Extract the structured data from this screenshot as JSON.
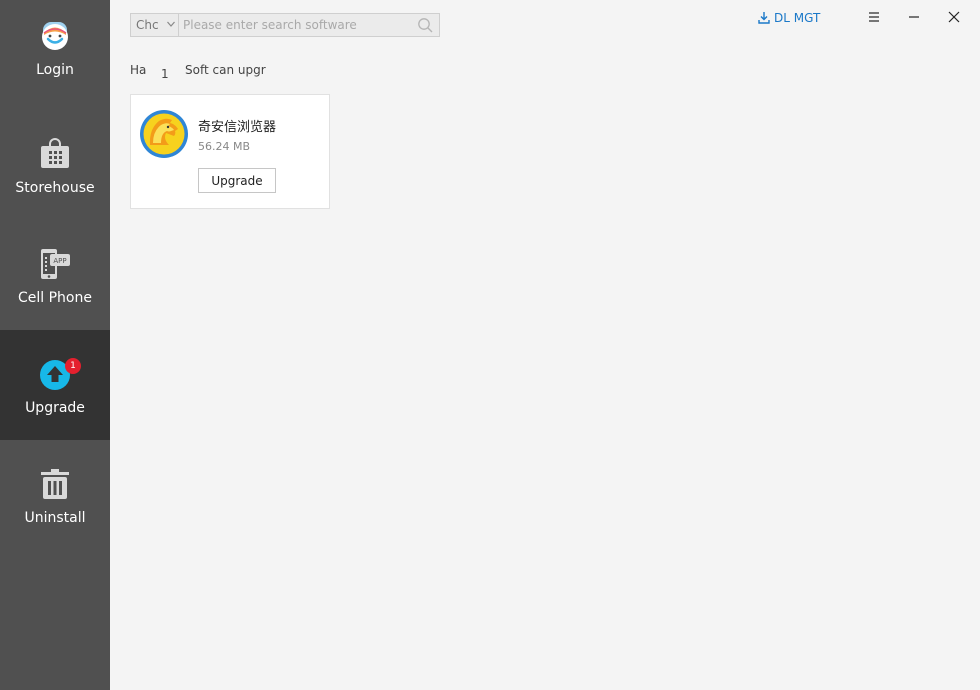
{
  "sidebar": {
    "items": [
      {
        "label": "Login",
        "icon": "avatar-icon"
      },
      {
        "label": "Storehouse",
        "icon": "shopping-bag-icon"
      },
      {
        "label": "Cell Phone",
        "icon": "phone-app-icon",
        "icon_text": "APP"
      },
      {
        "label": "Upgrade",
        "icon": "upgrade-arrow-icon",
        "badge": "1",
        "active": true
      },
      {
        "label": "Uninstall",
        "icon": "trash-icon"
      }
    ]
  },
  "search": {
    "category": "Chc",
    "placeholder": "Please enter search software",
    "value": ""
  },
  "header": {
    "download_manager": "DL MGT"
  },
  "summary": {
    "prefix": "Ha",
    "count": "1",
    "suffix": "Soft can upgr"
  },
  "apps": [
    {
      "name": "奇安信浏览器",
      "size": "56.24 MB",
      "action": "Upgrade"
    }
  ],
  "colors": {
    "sidebar": "#505050",
    "sidebar_active": "#333333",
    "accent": "#1a78c8",
    "badge": "#e4202e",
    "upgrade_icon": "#17b8e8"
  }
}
